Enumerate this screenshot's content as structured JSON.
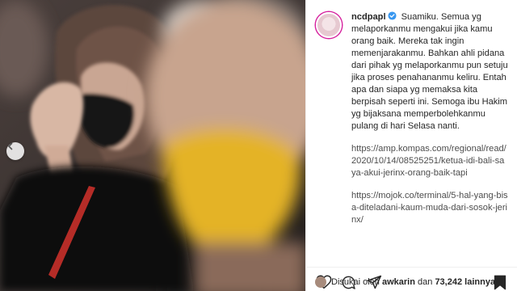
{
  "post": {
    "username": "ncdpapl",
    "caption_lines": [
      "Suamiku. Semua yg melaporkanmu mengakui jika kamu orang baik. Mereka tak ingin memenjarakanmu. Bahkan ahli pidana dari pihak yg melaporkanmu pun setuju jika proses penahananmu keliru. Entah apa dan siapa yg memaksa kita berpisah seperti ini. Semoga ibu Hakim yg bijaksana memperbolehkanmu pulang di hari Selasa nanti."
    ],
    "link1": "https://amp.kompas.com/regional/read/2020/10/14/08525251/ketua-idi-bali-saya-akui-jerinx-orang-baik-tapi",
    "link2": "https://mojok.co/terminal/5-hal-yang-bisa-diteladani-kaum-muda-dari-sosok-jerinx/"
  },
  "likes": {
    "prefix": "Disukai oleh",
    "user": "awkarin",
    "middle": "dan",
    "count": "73,242",
    "suffix": "lainnya"
  },
  "icons": {
    "verified": "verified-badge-icon",
    "like": "heart-icon",
    "comment": "comment-icon",
    "share": "paper-plane-icon",
    "save": "bookmark-icon",
    "carousel": "chevron-left-icon"
  },
  "colors": {
    "verified": "#3897f0",
    "text": "#262626",
    "border": "#efefef"
  }
}
